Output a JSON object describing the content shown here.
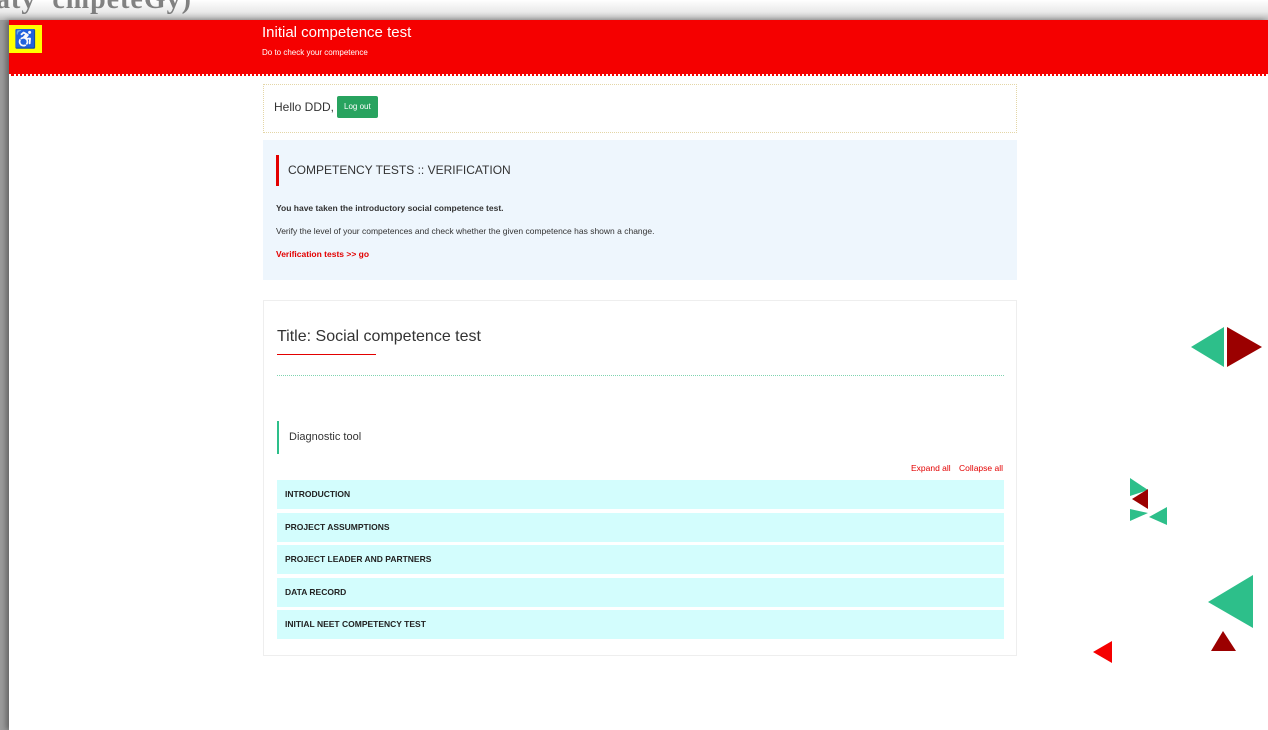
{
  "header": {
    "title": "Initial competence test",
    "subtitle": "Do to check your competence",
    "accessibility_icon": "wheelchair-icon"
  },
  "greeting": {
    "text": "Hello DDD,",
    "logout_label": "Log out"
  },
  "verification": {
    "heading": "COMPETENCY TESTS :: VERIFICATION",
    "bold_text": "You have taken the introductory social competence test.",
    "description": "Verify the level of your competences and check whether the given competence has shown a change.",
    "link_label": "Verification tests >> go"
  },
  "test": {
    "title": "Title: Social competence test",
    "section_label": "Diagnostic tool",
    "expand_all": "Expand all",
    "collapse_all": "Collapse all",
    "sections": [
      "INTRODUCTION",
      "PROJECT ASSUMPTIONS",
      "PROJECT LEADER AND PARTNERS",
      "DATA RECORD",
      "INITIAL NEET COMPETENCY TEST"
    ]
  },
  "colors": {
    "header_red": "#f50000",
    "accent_green": "#2dbf8a",
    "dark_red": "#9b0000",
    "button_green": "#28a35f",
    "accordion_bg": "#d3fdfd"
  }
}
